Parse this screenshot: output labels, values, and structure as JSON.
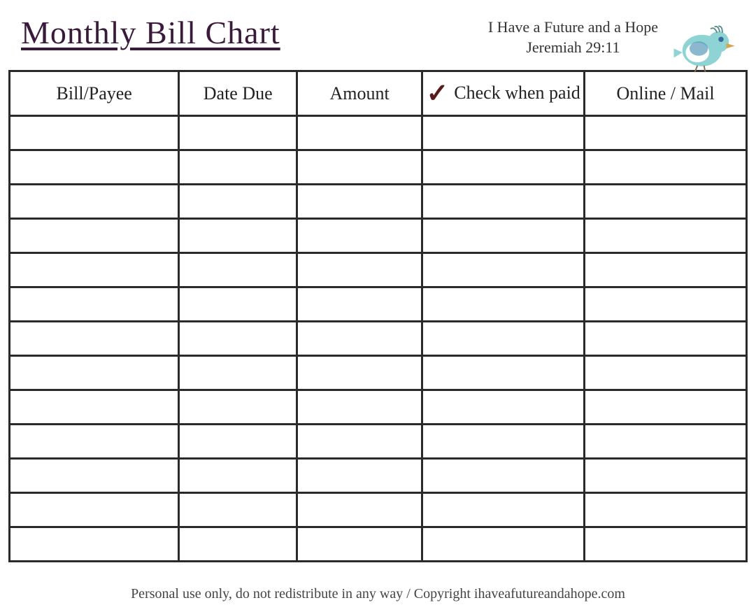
{
  "chart_data": {
    "type": "table",
    "title": "Monthly Bill Chart",
    "columns": [
      "Bill/Payee",
      "Date Due",
      "Amount",
      "Check when paid",
      "Online / Mail"
    ],
    "rows": [
      [
        "",
        "",
        "",
        "",
        ""
      ],
      [
        "",
        "",
        "",
        "",
        ""
      ],
      [
        "",
        "",
        "",
        "",
        ""
      ],
      [
        "",
        "",
        "",
        "",
        ""
      ],
      [
        "",
        "",
        "",
        "",
        ""
      ],
      [
        "",
        "",
        "",
        "",
        ""
      ],
      [
        "",
        "",
        "",
        "",
        ""
      ],
      [
        "",
        "",
        "",
        "",
        ""
      ],
      [
        "",
        "",
        "",
        "",
        ""
      ],
      [
        "",
        "",
        "",
        "",
        ""
      ],
      [
        "",
        "",
        "",
        "",
        ""
      ],
      [
        "",
        "",
        "",
        "",
        ""
      ],
      [
        "",
        "",
        "",
        "",
        ""
      ]
    ]
  },
  "header": {
    "title": "Monthly Bill Chart",
    "quote_line1": "I Have a Future and a Hope",
    "quote_line2": "Jeremiah 29:11"
  },
  "columns": {
    "bill": "Bill/Payee",
    "date": "Date Due",
    "amount": "Amount",
    "check": "Check when paid",
    "online": "Online / Mail"
  },
  "footer": "Personal use only, do not redistribute in any way / Copyright ihaveafutureandahope.com"
}
